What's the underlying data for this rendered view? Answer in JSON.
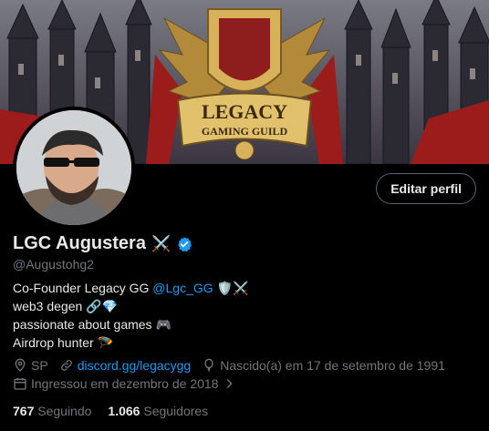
{
  "banner": {
    "title_line1": "LEGACY",
    "title_line2": "GAMING GUILD"
  },
  "profile": {
    "edit_label": "Editar perfil",
    "name": "LGC Augustera",
    "name_emoji": "⚔️",
    "handle": "@Augustohg2",
    "bio": {
      "line1_prefix": "Co-Founder Legacy GG ",
      "line1_mention": "@Lgc_GG",
      "line1_suffix": " 🛡️⚔️",
      "line2": "web3 degen 🔗💎",
      "line3": "passionate about games 🎮",
      "line4": "Airdrop hunter 🪂"
    },
    "location": "SP",
    "website": "discord.gg/legacygg",
    "birthday": "Nascido(a) em 17 de setembro de 1991",
    "joined": "Ingressou em dezembro de 2018",
    "following_count": "767",
    "following_label": "Seguindo",
    "followers_count": "1.066",
    "followers_label": "Seguidores"
  },
  "colors": {
    "accent": "#1d9bf0",
    "muted": "#71767b",
    "bg": "#000000"
  },
  "icons": [
    "location-icon",
    "link-icon",
    "balloon-icon",
    "calendar-icon",
    "chevron-right-icon",
    "verified-icon"
  ]
}
